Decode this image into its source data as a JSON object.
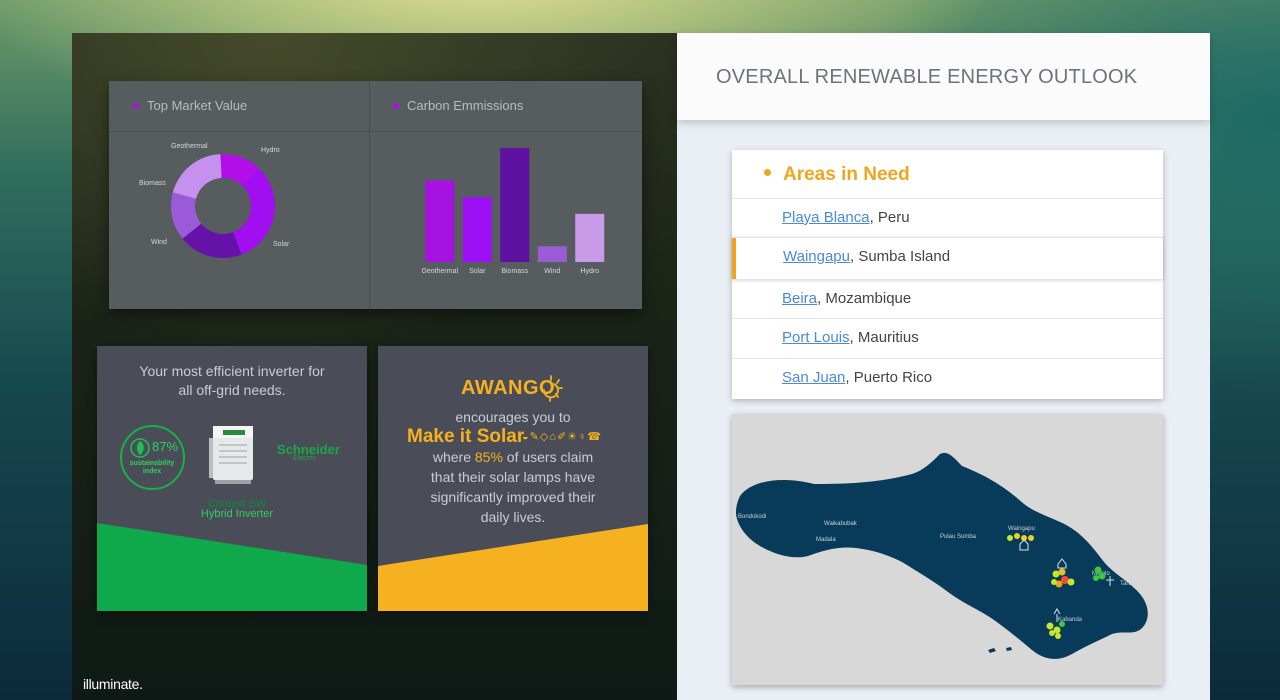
{
  "brand": "illuminate.",
  "charts": {
    "market_title": "Top Market Value",
    "carbon_title": "Carbon Emmissions"
  },
  "chart_data": [
    {
      "type": "pie",
      "title": "Top Market Value",
      "categories": [
        "Hydro",
        "Solar",
        "Wind",
        "Biomass",
        "Geothermal"
      ],
      "values": [
        13,
        32,
        20,
        15,
        20
      ],
      "colors": [
        "#b10ee8",
        "#a10ef0",
        "#6412a8",
        "#9b5ad8",
        "#c690ee"
      ]
    },
    {
      "type": "bar",
      "title": "Carbon Emmissions",
      "categories": [
        "Geothermal",
        "Solar",
        "Biomass",
        "Wind",
        "Hydro"
      ],
      "values": [
        83,
        66,
        116,
        16,
        49
      ],
      "colors": [
        "#a612e0",
        "#9b10f5",
        "#5e10a0",
        "#9a5cd5",
        "#c89ae8"
      ],
      "ylim": [
        0,
        120
      ]
    }
  ],
  "promo_inverter": {
    "heading_line1": "Your most efficient inverter for",
    "heading_line2": "all off-grid needs.",
    "sustainability_pct": "87%",
    "sustainability_label1": "sustainability",
    "sustainability_label2": "index",
    "brand_name": "Schneider",
    "brand_sub": "Electric",
    "product_line1": "Context SW",
    "product_line2": "Hybrid Inverter",
    "accent_color": "#0fa84a"
  },
  "promo_awango": {
    "logo": "AWANGO",
    "line1": "encourages you to",
    "headline": "Make it Solar",
    "line2_pre": "where ",
    "line2_pct": "85%",
    "line2_post": " of users claim",
    "line3": "that their solar lamps have",
    "line4": "significantly improved their",
    "line5": "daily lives.",
    "accent_color": "#f5b120"
  },
  "outlook": {
    "title": "OVERALL RENEWABLE ENERGY OUTLOOK"
  },
  "areas": {
    "title": "Areas in Need",
    "items": [
      {
        "place": "Playa Blanca",
        "region": ", Peru"
      },
      {
        "place": "Waingapu",
        "region": ", Sumba Island"
      },
      {
        "place": "Beira",
        "region": ", Mozambique"
      },
      {
        "place": "Port Louis",
        "region": ", Mauritius"
      },
      {
        "place": "San Juan",
        "region": ", Puerto Rico"
      }
    ]
  },
  "map": {
    "labels": [
      "Bondokodi",
      "Waikabubak",
      "Madala",
      "Pulau Sumba",
      "Waingapu",
      "Melolo",
      "Kabanda",
      "Tarau"
    ]
  }
}
